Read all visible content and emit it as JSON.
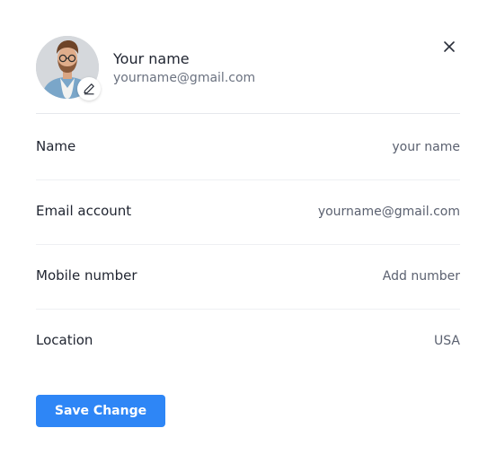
{
  "profile": {
    "name": "Your name",
    "email": "yourname@gmail.com",
    "avatar_icon": "user-photo",
    "edit_icon": "pencil-icon",
    "close_icon": "close-icon"
  },
  "fields": [
    {
      "label": "Name",
      "value": "your name"
    },
    {
      "label": "Email account",
      "value": "yourname@gmail.com"
    },
    {
      "label": "Mobile number",
      "value": "Add number"
    },
    {
      "label": "Location",
      "value": "USA"
    }
  ],
  "actions": {
    "save_label": "Save Change"
  },
  "colors": {
    "accent": "#2e86f6",
    "divider": "#eef0f3",
    "text_primary": "#1f2430",
    "text_secondary": "#6b7280"
  }
}
